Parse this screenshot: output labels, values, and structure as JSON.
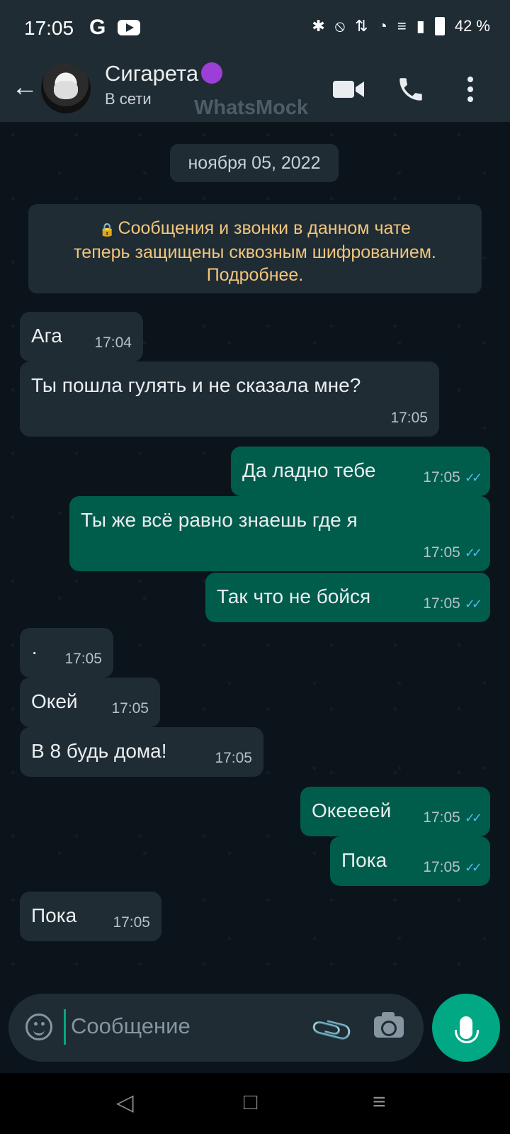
{
  "status_bar": {
    "time": "17:05",
    "battery": "42 %"
  },
  "header": {
    "contact_name": "Сигарета",
    "status": "В сети",
    "watermark": "WhatsMock"
  },
  "chat": {
    "date_chip": "ноября 05, 2022",
    "encryption_notice": {
      "line1": "Сообщения и звонки в данном чате",
      "line2": "теперь защищены сквозным шифрованием.",
      "line3": "Подробнее."
    },
    "messages": [
      {
        "direction": "in",
        "text": "Ага",
        "time": "17:04"
      },
      {
        "direction": "in",
        "text": "Ты пошла гулять и не сказала мне?",
        "time": "17:05"
      },
      {
        "direction": "out",
        "text": "Да ладно тебе",
        "time": "17:05",
        "read": true
      },
      {
        "direction": "out",
        "text": "Ты же всё равно знаешь где я",
        "time": "17:05",
        "read": true
      },
      {
        "direction": "out",
        "text": "Так что не бойся",
        "time": "17:05",
        "read": true
      },
      {
        "direction": "in",
        "text": "·",
        "time": "17:05"
      },
      {
        "direction": "in",
        "text": "Окей",
        "time": "17:05"
      },
      {
        "direction": "in",
        "text": "В 8 будь дома!",
        "time": "17:05"
      },
      {
        "direction": "out",
        "text": "Океееей",
        "time": "17:05",
        "read": true
      },
      {
        "direction": "out",
        "text": "Пока",
        "time": "17:05",
        "read": true
      },
      {
        "direction": "in",
        "text": "Пока",
        "time": "17:05"
      }
    ]
  },
  "composer": {
    "placeholder": "Сообщение"
  },
  "colors": {
    "background": "#0b141a",
    "incoming_bubble": "#1f2c34",
    "outgoing_bubble": "#005c4b",
    "accent": "#00a884",
    "read_ticks": "#53bdeb"
  }
}
